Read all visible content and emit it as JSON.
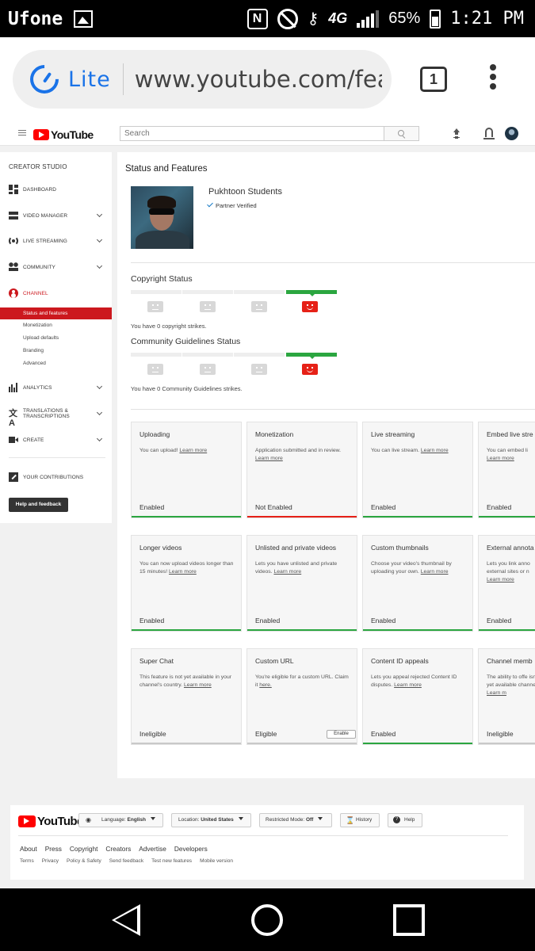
{
  "statusbar": {
    "carrier": "Ufone",
    "nfc_label": "N",
    "network": "4G",
    "battery": "65%",
    "time": "1:21 PM"
  },
  "browser": {
    "lite_label": "Lite",
    "url": "www.youtube.com/features",
    "tab_count": "1"
  },
  "masthead": {
    "logo_text": "YouTube",
    "search_placeholder": "Search"
  },
  "sidebar": {
    "title": "CREATOR STUDIO",
    "items": [
      {
        "label": "DASHBOARD"
      },
      {
        "label": "VIDEO MANAGER"
      },
      {
        "label": "LIVE STREAMING"
      },
      {
        "label": "COMMUNITY"
      },
      {
        "label": "CHANNEL"
      },
      {
        "label": "ANALYTICS"
      },
      {
        "label": "TRANSLATIONS & TRANSCRIPTIONS"
      },
      {
        "label": "CREATE"
      },
      {
        "label": "YOUR CONTRIBUTIONS"
      }
    ],
    "channel_subitems": [
      {
        "label": "Status and features"
      },
      {
        "label": "Monetization"
      },
      {
        "label": "Upload defaults"
      },
      {
        "label": "Branding"
      },
      {
        "label": "Advanced"
      }
    ],
    "help_button": "Help and feedback",
    "translate_glyph": "文A"
  },
  "main": {
    "title": "Status and Features",
    "channel_name": "Pukhtoon Students",
    "verified_label": "Partner Verified",
    "copyright": {
      "title": "Copyright Status",
      "text": "You have 0 copyright strikes."
    },
    "community": {
      "title": "Community Guidelines Status",
      "text": "You have 0 Community Guidelines strikes."
    },
    "learn_more": "Learn more",
    "cards": [
      {
        "title": "Uploading",
        "desc": "You can upload!",
        "link": "Learn more",
        "status": "Enabled"
      },
      {
        "title": "Monetization",
        "desc": "Application submitted and in review.",
        "link": "Learn more",
        "status": "Not Enabled"
      },
      {
        "title": "Live streaming",
        "desc": "You can live stream.",
        "link": "Learn more",
        "status": "Enabled"
      },
      {
        "title": "Embed live stre",
        "desc": "You can embed li",
        "link": "Learn more",
        "status": "Enabled"
      },
      {
        "title": "Longer videos",
        "desc": "You can now upload videos longer than 15 minutes!",
        "link": "Learn more",
        "status": "Enabled"
      },
      {
        "title": "Unlisted and private videos",
        "desc": "Lets you have unlisted and private videos.",
        "link": "Learn more",
        "status": "Enabled"
      },
      {
        "title": "Custom thumbnails",
        "desc": "Choose your video's thumbnail by uploading your own.",
        "link": "Learn more",
        "status": "Enabled"
      },
      {
        "title": "External annota",
        "desc": "Lets you link anno external sites or n",
        "link": "Learn more",
        "status": "Enabled"
      },
      {
        "title": "Super Chat",
        "desc": "This feature is not yet available in your channel's country.",
        "link": "Learn more",
        "status": "Ineligible"
      },
      {
        "title": "Custom URL",
        "desc": "You're eligible for a custom URL. Claim it",
        "link": "here.",
        "status": "Eligible",
        "button": "Enable"
      },
      {
        "title": "Content ID appeals",
        "desc": "Lets you appeal rejected Content ID disputes.",
        "link": "Learn more",
        "status": "Enabled"
      },
      {
        "title": "Channel memb",
        "desc": "The ability to offe isn't yet available channel.",
        "link": "Learn m",
        "status": "Ineligible"
      }
    ]
  },
  "footer": {
    "logo_text": "YouTube",
    "language_label": "Language:",
    "language_value": "English",
    "location_label": "Location:",
    "location_value": "United States",
    "restricted_label": "Restricted Mode:",
    "restricted_value": "Off",
    "history": "History",
    "help": "Help",
    "links": [
      "About",
      "Press",
      "Copyright",
      "Creators",
      "Advertise",
      "Developers"
    ],
    "sublinks": [
      "Terms",
      "Privacy",
      "Policy & Safety",
      "Send feedback",
      "Test new features",
      "Mobile version"
    ]
  },
  "colors": {
    "youtube_red": "#ff0000",
    "channel_red": "#cc181e",
    "enabled_green": "#2ba640",
    "not_enabled_red": "#e62117",
    "lite_blue": "#1a73e8"
  }
}
